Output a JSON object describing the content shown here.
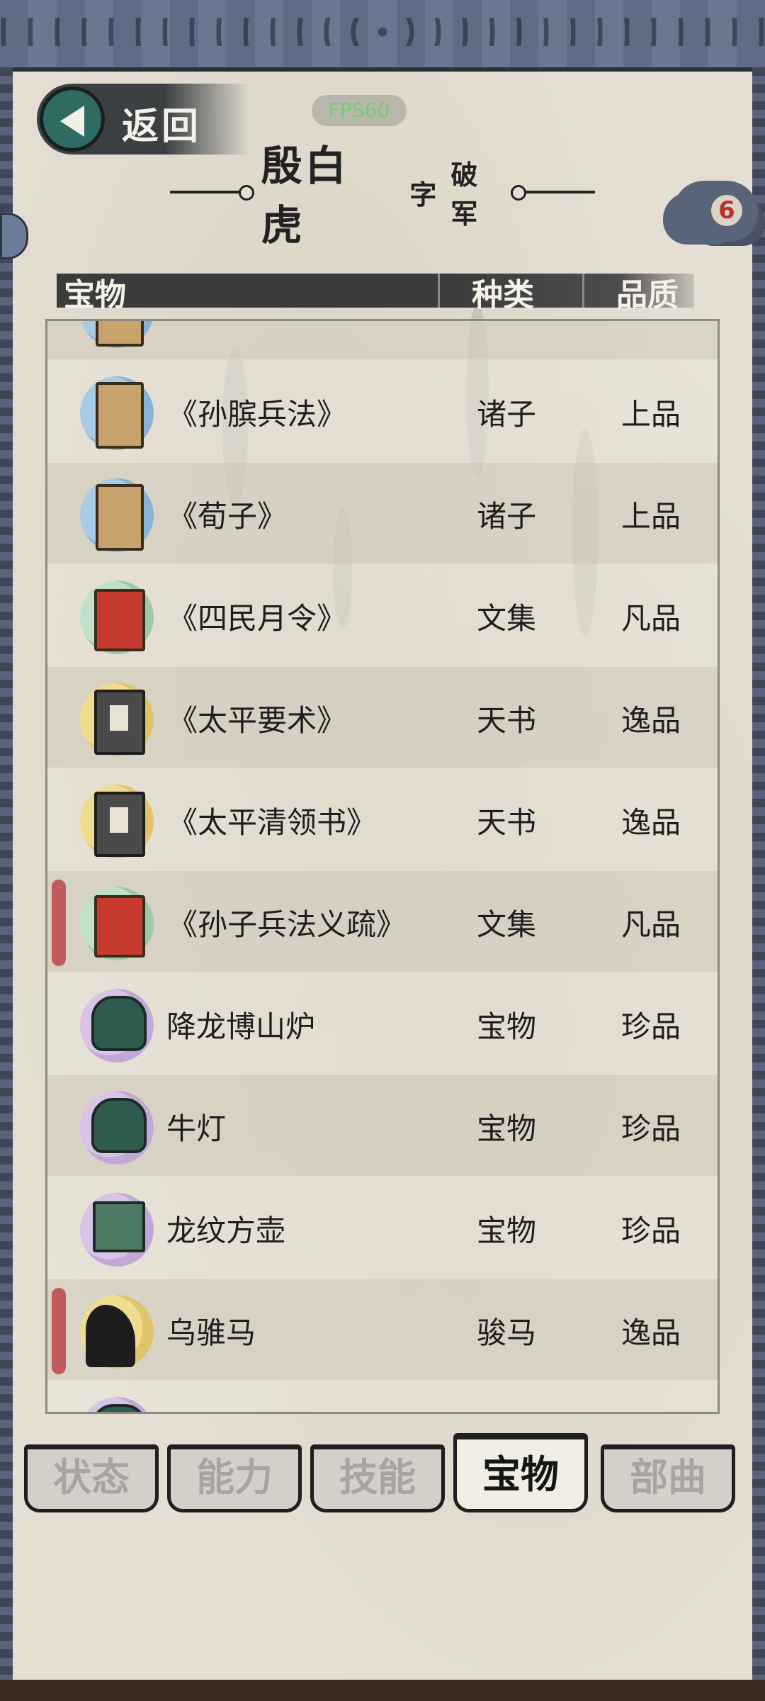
{
  "header": {
    "back_label": "返回",
    "fps": "FPS60",
    "title_name": "殷白虎",
    "title_zi": "字",
    "title_courtesy": "破军",
    "badge": "6"
  },
  "columns": {
    "item": "宝物",
    "type": "种类",
    "quality": "品质"
  },
  "rows": [
    {
      "name": "《孙膑兵法》",
      "type": "诸子",
      "quality": "上品",
      "icon": "book-icon"
    },
    {
      "name": "《荀子》",
      "type": "诸子",
      "quality": "上品",
      "icon": "book-icon"
    },
    {
      "name": "《四民月令》",
      "type": "文集",
      "quality": "凡品",
      "icon": "red-book-icon"
    },
    {
      "name": "《太平要术》",
      "type": "天书",
      "quality": "逸品",
      "icon": "dark-book-icon"
    },
    {
      "name": "《太平清领书》",
      "type": "天书",
      "quality": "逸品",
      "icon": "dark-book-icon"
    },
    {
      "name": "《孙子兵法义疏》",
      "type": "文集",
      "quality": "凡品",
      "icon": "red-book-icon"
    },
    {
      "name": "降龙博山炉",
      "type": "宝物",
      "quality": "珍品",
      "icon": "bronze-censer-icon"
    },
    {
      "name": "牛灯",
      "type": "宝物",
      "quality": "珍品",
      "icon": "bronze-lamp-icon"
    },
    {
      "name": "龙纹方壶",
      "type": "宝物",
      "quality": "珍品",
      "icon": "bronze-vessel-icon"
    },
    {
      "name": "乌骓马",
      "type": "骏马",
      "quality": "逸品",
      "icon": "horse-icon"
    }
  ],
  "tabs": [
    {
      "label": "状态",
      "active": false
    },
    {
      "label": "能力",
      "active": false
    },
    {
      "label": "技能",
      "active": false
    },
    {
      "label": "宝物",
      "active": true
    },
    {
      "label": "部曲",
      "active": false
    }
  ],
  "colors": {
    "paper": "#e4dfd2",
    "header_bar": "#3b3b3b",
    "marker": "#c15a5a",
    "fps_text": "#6fd06f"
  }
}
